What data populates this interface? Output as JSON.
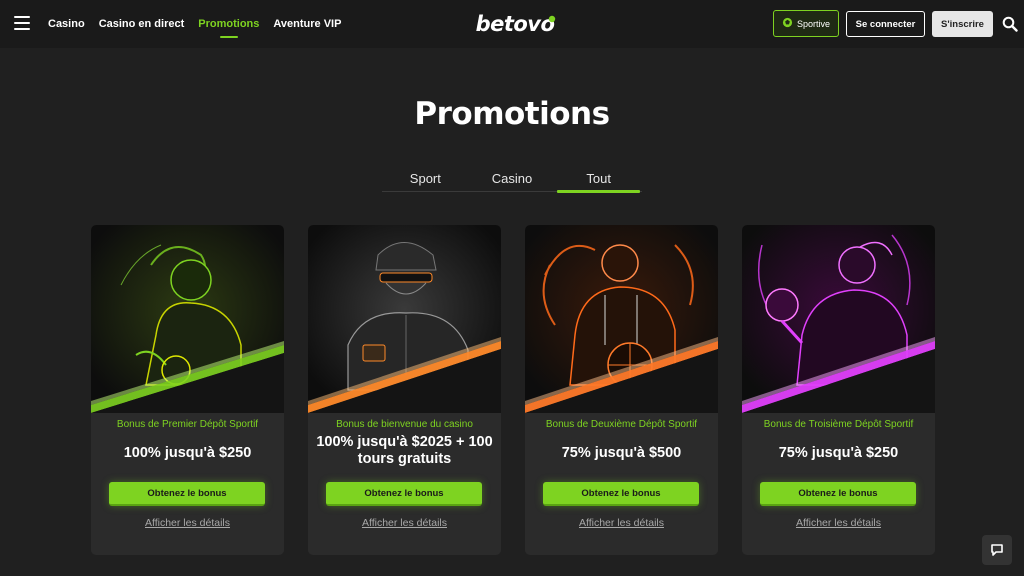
{
  "header": {
    "nav": [
      "Casino",
      "Casino en direct",
      "Promotions",
      "Aventure VIP"
    ],
    "active_nav": "Promotions",
    "logo": "betovo",
    "sportive_label": "Sportive",
    "login_label": "Se connecter",
    "signup_label": "S'inscrire"
  },
  "page": {
    "title": "Promotions",
    "tabs": [
      "Sport",
      "Casino",
      "Tout"
    ],
    "active_tab": "Tout"
  },
  "cards": [
    {
      "subtitle": "Bonus de Premier Dépôt Sportif",
      "title": "100% jusqu'à $250",
      "button": "Obtenez le bonus",
      "link": "Afficher les détails",
      "theme_color": "#7ed321",
      "image": "soccer-player"
    },
    {
      "subtitle": "Bonus de bienvenue du casino",
      "title": "100% jusqu'à $2025 + 100 tours gratuits",
      "button": "Obtenez le bonus",
      "link": "Afficher les détails",
      "theme_color": "#ff8a2a",
      "image": "card-player"
    },
    {
      "subtitle": "Bonus de Deuxième Dépôt Sportif",
      "title": "75% jusqu'à $500",
      "button": "Obtenez le bonus",
      "link": "Afficher les détails",
      "theme_color": "#ff6a1a",
      "image": "basketball-player"
    },
    {
      "subtitle": "Bonus de Troisième Dépôt Sportif",
      "title": "75% jusqu'à $250",
      "button": "Obtenez le bonus",
      "link": "Afficher les détails",
      "theme_color": "#e040fb",
      "image": "boxer"
    }
  ],
  "colors": {
    "accent": "#7ed321",
    "background": "#202020",
    "header_bg": "#1a1a1a",
    "card_bg": "#2b2b2b"
  },
  "icons": [
    "menu-icon",
    "sportive-icon",
    "search-icon",
    "chat-icon"
  ]
}
